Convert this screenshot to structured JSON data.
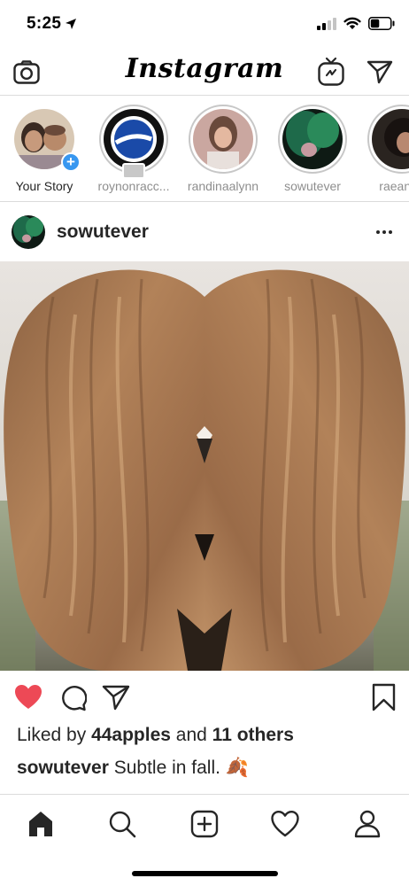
{
  "status_bar": {
    "time": "5:25",
    "location_icon": "location-arrow-icon",
    "signal_icon": "cellular-signal-icon",
    "wifi_icon": "wifi-icon",
    "battery_icon": "battery-icon",
    "battery_level": 0.45
  },
  "header": {
    "logo": "Instagram",
    "camera_icon": "camera-icon",
    "igtv_icon": "igtv-icon",
    "direct_icon": "paper-plane-icon"
  },
  "stories": [
    {
      "username": "Your Story",
      "own": true
    },
    {
      "username": "roynonracc...",
      "own": false
    },
    {
      "username": "randinaalynn",
      "own": false
    },
    {
      "username": "sowutever",
      "own": false
    },
    {
      "username": "raeann_",
      "own": false
    }
  ],
  "post": {
    "username": "sowutever",
    "more_icon": "more-options-icon",
    "liked": true,
    "likes": {
      "prefix": "Liked by ",
      "user": "44apples",
      "middle": " and ",
      "others": "11 others"
    },
    "caption": {
      "user": "sowutever",
      "text": " Subtle in fall. 🍂"
    }
  },
  "nav": {
    "items": [
      "home-icon",
      "search-icon",
      "new-post-icon",
      "activity-heart-icon",
      "profile-icon"
    ]
  },
  "colors": {
    "like_red": "#ed4956",
    "add_blue": "#3897f0",
    "border": "#dbdbdb",
    "text": "#262626",
    "muted": "#8e8e8e"
  }
}
